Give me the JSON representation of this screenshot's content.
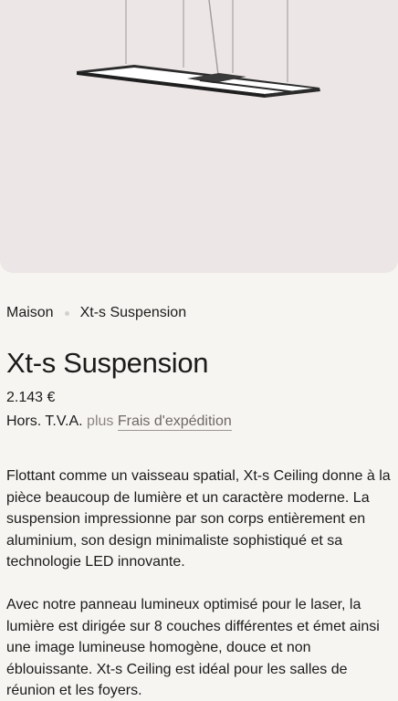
{
  "colors": {
    "page_background": "#f7f5f2",
    "hero_background": "#ece6e6",
    "fixture_frame": "#2b2b2b",
    "link_muted": "#8b8682"
  },
  "hero": {
    "image_subject": "pendant-led-panel-lamp"
  },
  "breadcrumb": {
    "home_label": "Maison",
    "current_label": "Xt-s Suspension"
  },
  "product": {
    "title": "Xt-s Suspension",
    "price": "2.143 €",
    "tax_note": "Hors. T.V.A.",
    "plus_text": "plus",
    "shipping_link": "Frais d'expédition"
  },
  "description": {
    "paragraph_1": "Flottant comme un vaisseau spatial, Xt-s Ceiling donne à la pièce beaucoup de lumière et un caractère moderne. La suspension impressionne par son corps entièrement en aluminium, son design minimaliste sophistiqué et sa technologie LED innovante.",
    "paragraph_2": "Avec notre panneau lumineux optimisé pour le laser, la lumière est dirigée sur 8 couches différentes et émet ainsi une image lumineuse homogène, douce et non éblouissante. Xt-s Ceiling est idéal pour les salles de réunion et les foyers."
  }
}
